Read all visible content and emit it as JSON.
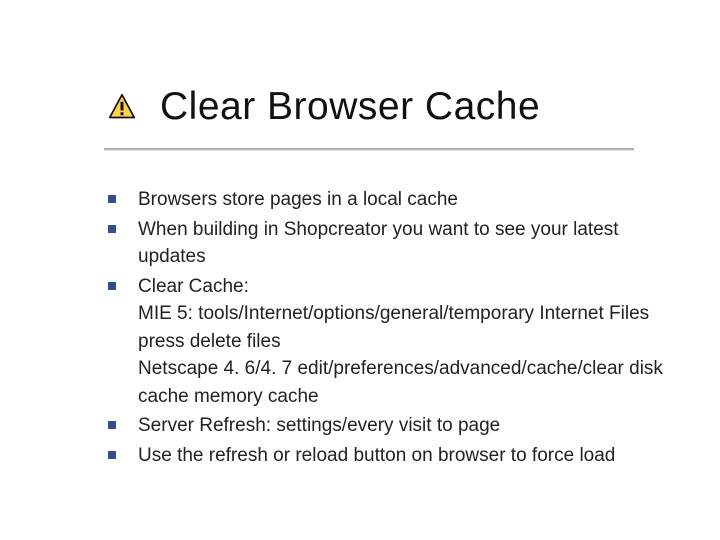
{
  "title": "Clear Browser Cache",
  "bullets": [
    "Browsers store pages in a local cache",
    "When building in Shopcreator you want to see your latest updates",
    "Clear Cache:\nMIE 5: tools/Internet/options/general/temporary Internet Files press delete files\nNetscape 4. 6/4. 7 edit/preferences/advanced/cache/clear disk cache memory cache",
    "Server Refresh: settings/every visit to page",
    "Use the refresh or reload button on browser to force load"
  ]
}
